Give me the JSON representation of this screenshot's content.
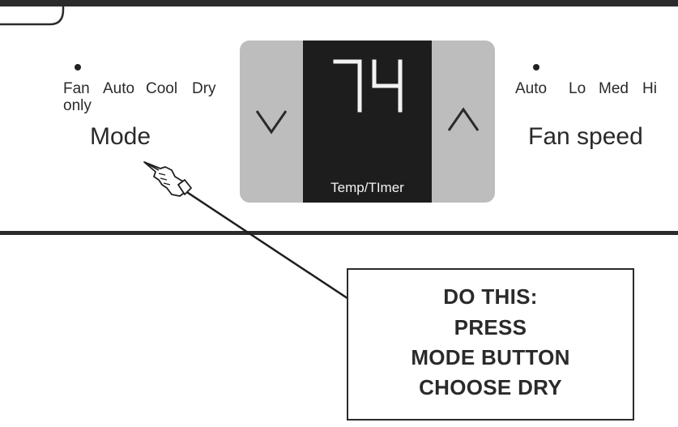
{
  "mode": {
    "options": [
      "Fan",
      "Auto",
      "Cool",
      "Dry"
    ],
    "fan_suffix": "only",
    "label": "Mode"
  },
  "display": {
    "temperature": "74",
    "label": "Temp/TImer"
  },
  "fan_speed": {
    "options": [
      "Auto",
      "Lo",
      "Med",
      "Hi"
    ],
    "label": "Fan speed"
  },
  "instruction": {
    "lines": [
      "DO THIS:",
      "PRESS",
      "MODE BUTTON",
      "CHOOSE DRY"
    ]
  },
  "icons": [
    "chevron-down-icon",
    "chevron-up-icon",
    "pointing-hand-icon"
  ],
  "colors": {
    "bezel": "#bdbdbd",
    "display_bg": "#1d1d1d",
    "display_text": "#f2f2f2",
    "lines": "#2b2b2b"
  }
}
